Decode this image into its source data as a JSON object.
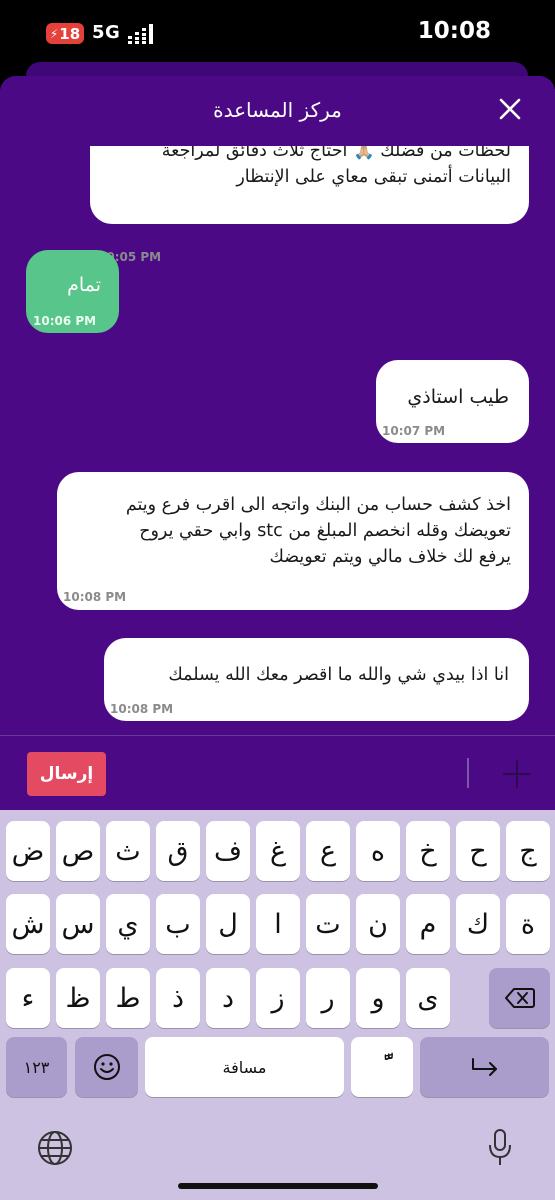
{
  "status_bar": {
    "battery": "18",
    "network": "5G",
    "time": "10:08"
  },
  "header": {
    "title": "مركز المساعدة",
    "close_icon": "close-icon"
  },
  "messages": [
    {
      "id": "m1",
      "sender": "agent",
      "lines": [
        "لحظات من فضلك 🙏🏼 أحتاج ثلاث دقائق لمراجعة",
        "البيانات أتمنى تبقى معاي على الإنتظار"
      ],
      "time": "10:05 PM"
    },
    {
      "id": "m2",
      "sender": "user",
      "lines": [
        "تمام"
      ],
      "time": "10:06 PM"
    },
    {
      "id": "m3",
      "sender": "agent",
      "lines": [
        "طيب استاذي"
      ],
      "time": "10:07 PM"
    },
    {
      "id": "m4",
      "sender": "agent",
      "lines": [
        "اخذ كشف حساب من البنك واتجه الى اقرب فرع ويتم",
        "تعويضك وقله انخصم المبلغ من stc وابي حقي يروح",
        "يرفع لك خلاف مالي ويتم تعويضك"
      ],
      "time": "10:08 PM"
    },
    {
      "id": "m5",
      "sender": "agent",
      "lines": [
        "انا اذا بيدي شي والله ما اقصر معك الله يسلمك"
      ],
      "time": "10:08 PM"
    }
  ],
  "composer": {
    "send_label": "إرسال",
    "add_icon": "plus-icon"
  },
  "keyboard": {
    "row1": [
      "ض",
      "ص",
      "ث",
      "ق",
      "ف",
      "غ",
      "ع",
      "ه",
      "خ",
      "ح",
      "ج"
    ],
    "row2": [
      "ش",
      "س",
      "ي",
      "ب",
      "ل",
      "ا",
      "ت",
      "ن",
      "م",
      "ك",
      "ة"
    ],
    "row3": [
      "ء",
      "ظ",
      "ط",
      "ذ",
      "د",
      "ز",
      "ر",
      "و",
      "ى"
    ],
    "numbers_label": "١٢٣",
    "space_label": "مسافة",
    "diacritic_label": "ًّ",
    "emoji_icon": "emoji-icon",
    "globe_icon": "globe-icon",
    "mic_icon": "microphone-icon",
    "backspace_icon": "backspace-icon",
    "return_icon": "return-icon"
  },
  "colors": {
    "sheet": "#4c0986",
    "user_bubble": "#58c58a",
    "send_button": "#e44b63",
    "keyboard": "#cec2e3"
  }
}
